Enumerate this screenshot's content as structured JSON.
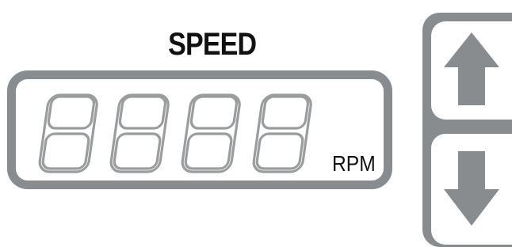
{
  "title": "SPEED",
  "display": {
    "digits": [
      "8",
      "8",
      "8",
      "8"
    ],
    "unit": "RPM"
  },
  "controls": {
    "up_icon": "arrow-up-icon",
    "down_icon": "arrow-down-icon"
  },
  "colors": {
    "frame": "#888c8f",
    "segment": "#9a9c9e",
    "text": "#111111"
  }
}
